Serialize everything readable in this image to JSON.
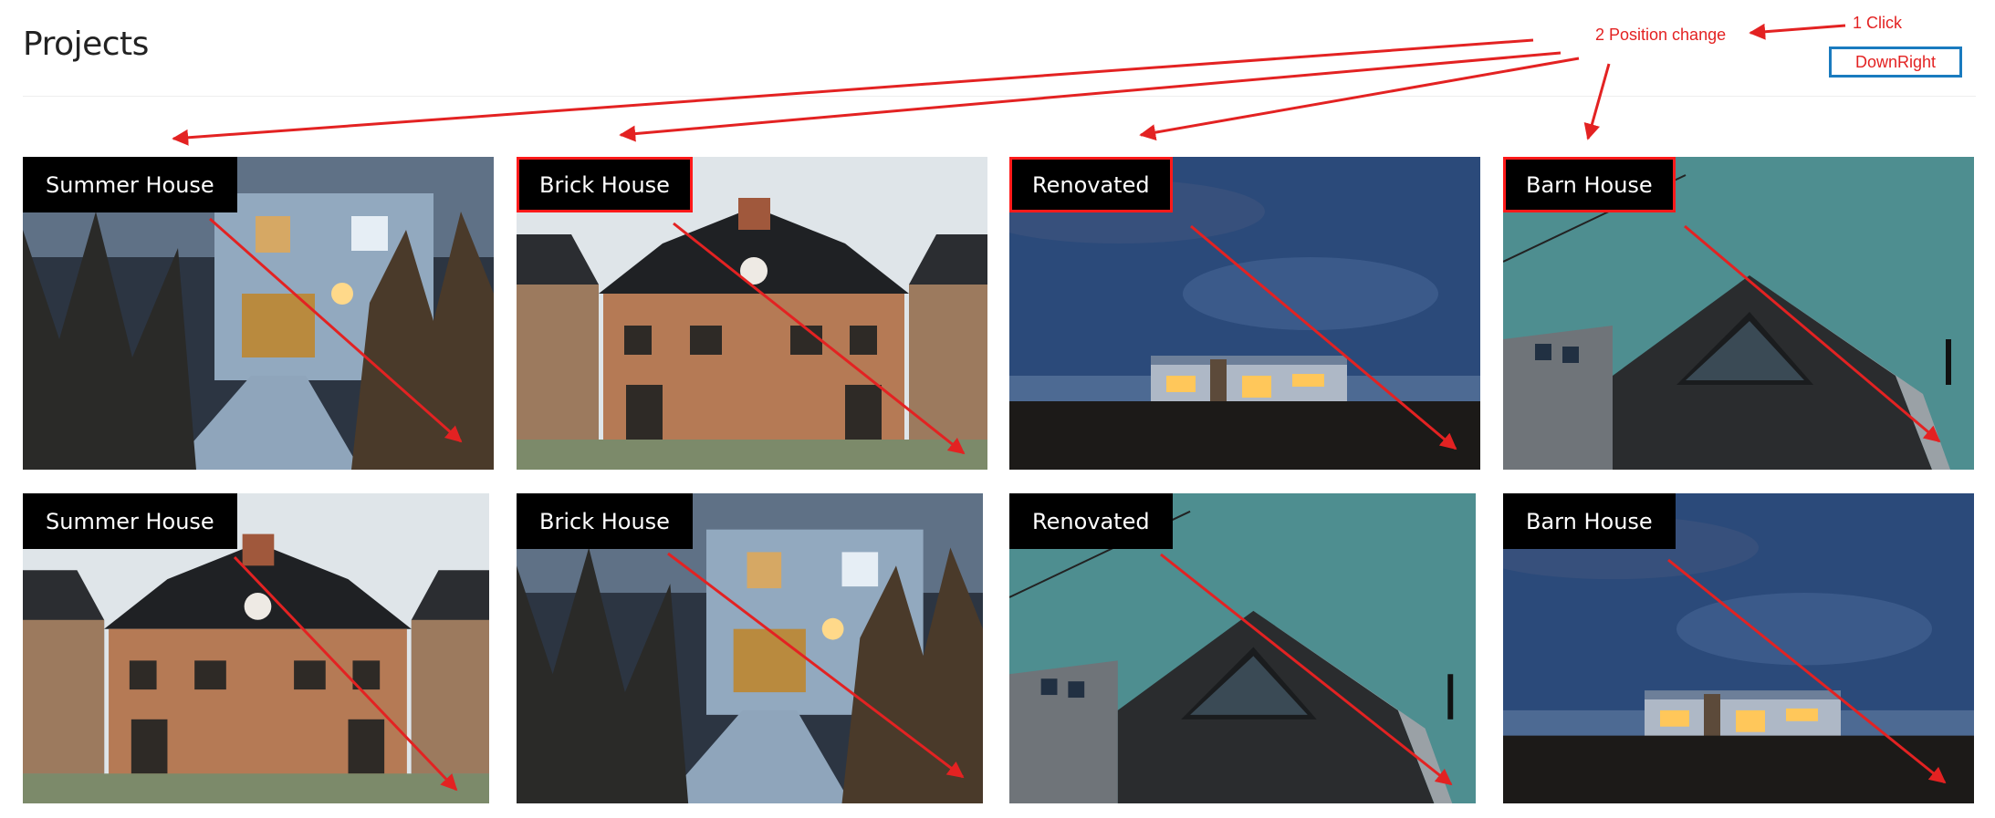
{
  "header": {
    "title": "Projects",
    "action_button_label": "DownRight"
  },
  "annotations": {
    "step1": "1 Click",
    "step2": "2 Position change",
    "color": "#e32222"
  },
  "grid": {
    "row1": [
      {
        "label": "Summer House",
        "photo": "wooden-walkway-house",
        "highlighted": false
      },
      {
        "label": "Brick House",
        "photo": "brick-house",
        "highlighted": true
      },
      {
        "label": "Renovated",
        "photo": "night-bungalow",
        "highlighted": true
      },
      {
        "label": "Barn House",
        "photo": "barn-house",
        "highlighted": true
      }
    ],
    "row2": [
      {
        "label": "Summer House",
        "photo": "brick-house",
        "highlighted": false
      },
      {
        "label": "Brick House",
        "photo": "wooden-walkway-house",
        "highlighted": false
      },
      {
        "label": "Renovated",
        "photo": "barn-house",
        "highlighted": false
      },
      {
        "label": "Barn House",
        "photo": "night-bungalow",
        "highlighted": false
      }
    ]
  },
  "colors": {
    "label_bg": "#000000",
    "label_text": "#ffffff",
    "highlight": "#ff1a1a",
    "button_border": "#1a7bbf"
  }
}
